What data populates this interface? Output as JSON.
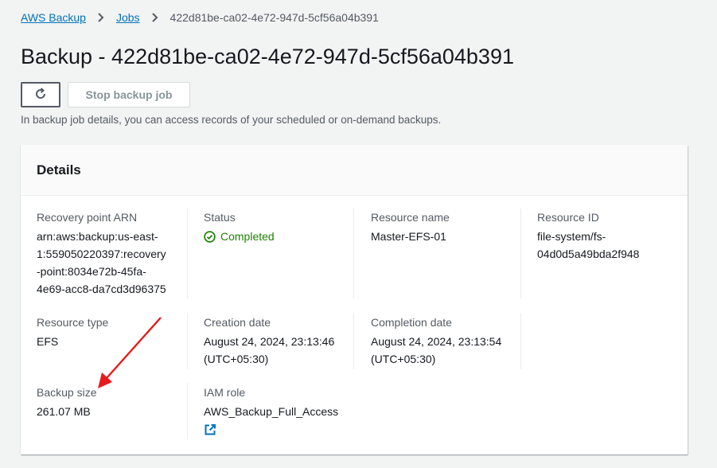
{
  "breadcrumb": {
    "root": "AWS Backup",
    "jobs": "Jobs",
    "current": "422d81be-ca02-4e72-947d-5cf56a04b391"
  },
  "page": {
    "title": "Backup - 422d81be-ca02-4e72-947d-5cf56a04b391",
    "stop_button": "Stop backup job",
    "description": "In backup job details, you can access records of your scheduled or on-demand backups."
  },
  "details": {
    "heading": "Details",
    "recovery_point_arn": {
      "label": "Recovery point ARN",
      "line1": "arn:aws:backup:us-east-",
      "line2": "1:559050220397:recovery",
      "line3": "-point:8034e72b-45fa-",
      "line4": "4e69-acc8-da7cd3d96375"
    },
    "status": {
      "label": "Status",
      "value": "Completed"
    },
    "resource_name": {
      "label": "Resource name",
      "value": "Master-EFS-01"
    },
    "resource_id": {
      "label": "Resource ID",
      "line1": "file-system/fs-",
      "line2": "04d0d5a49bda2f948"
    },
    "resource_type": {
      "label": "Resource type",
      "value": "EFS"
    },
    "creation_date": {
      "label": "Creation date",
      "line1": "August 24, 2024, 23:13:46",
      "line2": "(UTC+05:30)"
    },
    "completion_date": {
      "label": "Completion date",
      "line1": "August 24, 2024, 23:13:54",
      "line2": "(UTC+05:30)"
    },
    "backup_size": {
      "label": "Backup size",
      "value": "261.07 MB"
    },
    "iam_role": {
      "label": "IAM role",
      "value": "AWS_Backup_Full_Access"
    }
  },
  "colors": {
    "link": "#0073bb",
    "success": "#1d8102",
    "annotation_arrow": "#e8191b"
  },
  "icons": [
    "chevron-right-icon",
    "refresh-icon",
    "check-circle-icon",
    "external-link-icon",
    "annotation-arrow"
  ]
}
